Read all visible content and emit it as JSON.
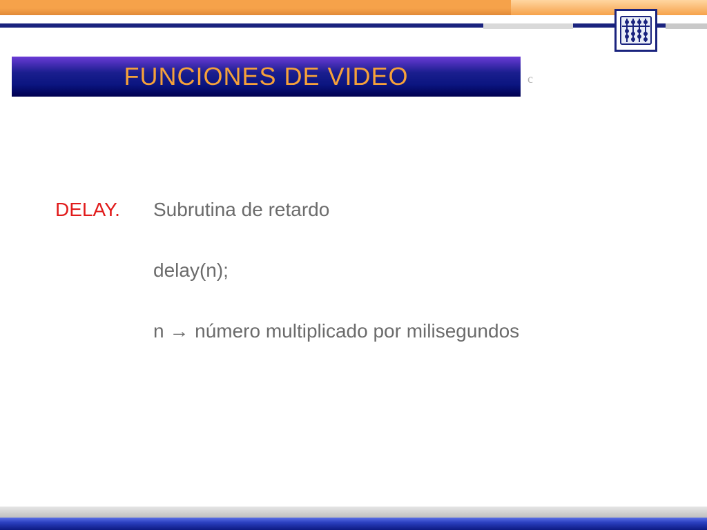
{
  "title": "FUNCIONES DE VIDEO",
  "label": "DELAY.",
  "line1": "Subrutina de retardo",
  "line2": "delay(n);",
  "line3_prefix": "n ",
  "line3_arrow": "→",
  "line3_suffix": " número multiplicado por milisegundos",
  "behind_char": "c",
  "colors": {
    "title_bg_top": "#6a3bd6",
    "title_bg_bottom": "#000050",
    "title_text": "#f5a13a",
    "label": "#e11b1b",
    "body": "#6b6b6b",
    "orange": "#f6a24a",
    "blue": "#1a237e"
  }
}
